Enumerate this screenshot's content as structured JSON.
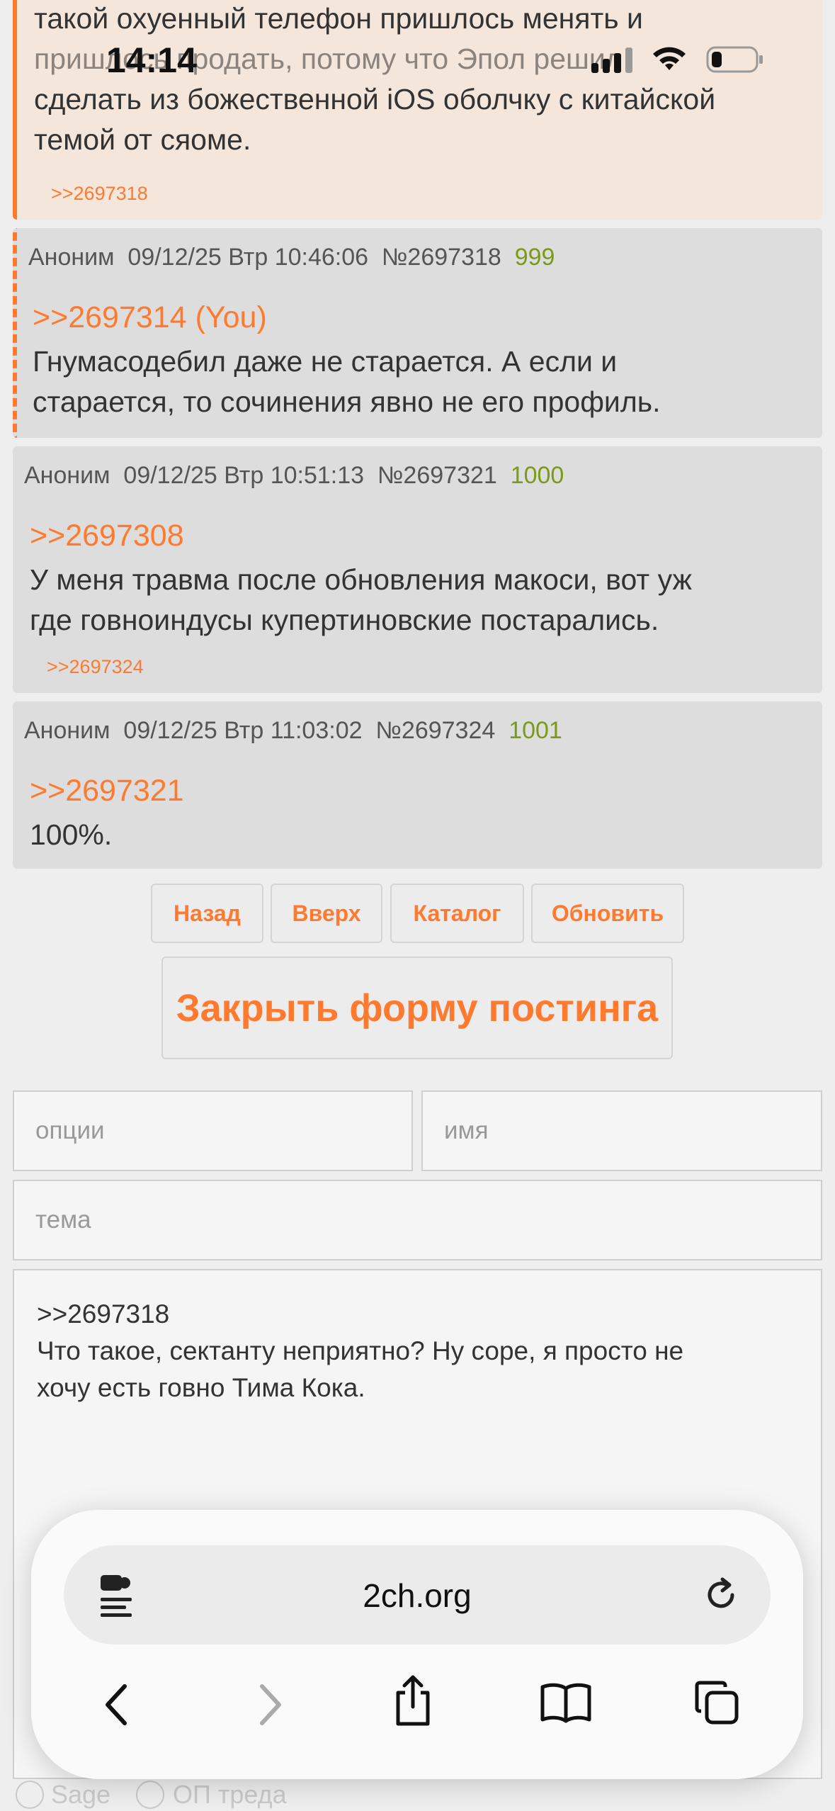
{
  "status_bar": {
    "time": "14:14"
  },
  "posts": [
    {
      "lines": [
        "такой охуенный телефон пришлось менять и",
        "пришлось продать, потому что Эпол решил",
        "сделать из божественной iOS оболчку с китайской",
        "темой от сяоме."
      ],
      "backlink": ">>2697318"
    },
    {
      "author": "Аноним",
      "date": "09/12/25 Втр 10:46:06",
      "number": "№2697318",
      "count": "999",
      "reply_to": ">>2697314 (You)",
      "lines": [
        "Гнумасодебил даже не старается. А если и",
        "старается, то сочинения явно не его профиль."
      ]
    },
    {
      "author": "Аноним",
      "date": "09/12/25 Втр 10:51:13",
      "number": "№2697321",
      "count": "1000",
      "reply_to": ">>2697308",
      "lines": [
        "У меня травма после обновления макоси, вот уж",
        "где говноиндусы купертиновские постарались."
      ],
      "backlink": ">>2697324"
    },
    {
      "author": "Аноним",
      "date": "09/12/25 Втр 11:03:02",
      "number": "№2697324",
      "count": "1001",
      "reply_to": ">>2697321",
      "lines": [
        "100%."
      ]
    }
  ],
  "nav": {
    "back": "Назад",
    "up": "Вверх",
    "catalog": "Каталог",
    "refresh": "Обновить"
  },
  "form": {
    "close_label": "Закрыть форму постинга",
    "options_placeholder": "опции",
    "name_placeholder": "имя",
    "subject_placeholder": "тема",
    "message": ">>2697318\nЧто такое, сектанту неприятно? Ну соре, я просто не\nхочу есть говно Тима Кока.",
    "sage_label": "Sage",
    "op_label": "ОП треда"
  },
  "browser": {
    "url": "2ch.org"
  }
}
